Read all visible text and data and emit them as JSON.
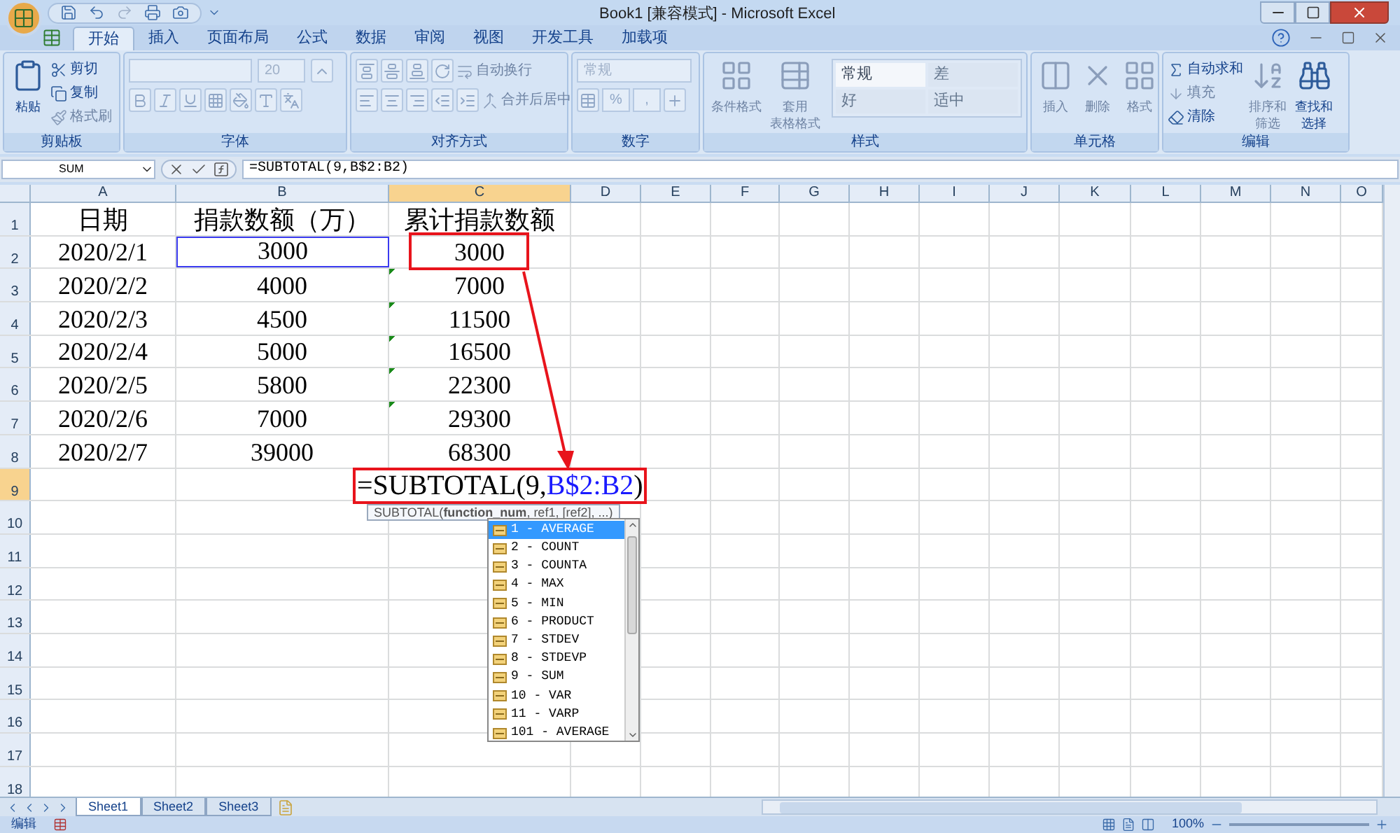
{
  "window": {
    "title": "Book1  [兼容模式] - Microsoft Excel"
  },
  "tabs": [
    {
      "label": "开始",
      "selected": true
    },
    {
      "label": "插入",
      "selected": false
    },
    {
      "label": "页面布局",
      "selected": false
    },
    {
      "label": "公式",
      "selected": false
    },
    {
      "label": "数据",
      "selected": false
    },
    {
      "label": "审阅",
      "selected": false
    },
    {
      "label": "视图",
      "selected": false
    },
    {
      "label": "开发工具",
      "selected": false
    },
    {
      "label": "加载项",
      "selected": false
    }
  ],
  "ribbon": [
    {
      "kind": "clipboard",
      "title": "剪贴板",
      "large": {
        "label": "粘贴",
        "disabled": false
      },
      "small": [
        {
          "label": "剪切",
          "disabled": false
        },
        {
          "label": "复制",
          "disabled": false
        },
        {
          "label": "格式刷",
          "disabled": true
        }
      ]
    },
    {
      "kind": "font",
      "title": "字体",
      "font_size": "20"
    },
    {
      "kind": "alignment",
      "title": "对齐方式",
      "wrap": "自动换行",
      "merge": "合并后居中"
    },
    {
      "kind": "number",
      "title": "数字",
      "format": "常规",
      "percent": "%",
      "comma": ","
    },
    {
      "kind": "styles",
      "title": "样式",
      "large": [
        {
          "lines": [
            "条件格式"
          ]
        },
        {
          "lines": [
            "套用",
            "表格格式"
          ]
        }
      ],
      "gallery": [
        {
          "label": "常规",
          "selected": true
        },
        {
          "label": "差",
          "selected": false
        },
        {
          "label": "好",
          "selected": false
        },
        {
          "label": "适中",
          "selected": false
        }
      ]
    },
    {
      "kind": "cells",
      "title": "单元格",
      "large": [
        {
          "lines": [
            "插入"
          ]
        },
        {
          "lines": [
            "删除"
          ]
        },
        {
          "lines": [
            "格式"
          ]
        }
      ]
    },
    {
      "kind": "editing",
      "title": "编辑",
      "small": [
        {
          "label": "自动求和",
          "disabled": false
        },
        {
          "label": "填充",
          "disabled": true
        },
        {
          "label": "清除",
          "disabled": false
        }
      ],
      "large": [
        {
          "lines": [
            "排序和",
            "筛选"
          ],
          "disabled": true
        },
        {
          "lines": [
            "查找和",
            "选择"
          ],
          "disabled": false
        }
      ]
    }
  ],
  "formula_bar": {
    "name_box": "SUM",
    "formula": "=SUBTOTAL(9,B$2:B2)"
  },
  "columns": [
    {
      "label": "A",
      "selected": false
    },
    {
      "label": "B",
      "selected": false
    },
    {
      "label": "C",
      "selected": true
    },
    {
      "label": "D",
      "selected": false
    },
    {
      "label": "E",
      "selected": false
    },
    {
      "label": "F",
      "selected": false
    },
    {
      "label": "G",
      "selected": false
    },
    {
      "label": "H",
      "selected": false
    },
    {
      "label": "I",
      "selected": false
    },
    {
      "label": "J",
      "selected": false
    },
    {
      "label": "K",
      "selected": false
    },
    {
      "label": "L",
      "selected": false
    },
    {
      "label": "M",
      "selected": false
    },
    {
      "label": "N",
      "selected": false
    },
    {
      "label": "O",
      "selected": false
    }
  ],
  "rows": [
    {
      "number": "1",
      "selected": false,
      "cells": [
        {
          "text": "日期",
          "reference": false,
          "marker": false
        },
        {
          "text": "捐款数额（万）",
          "reference": false,
          "marker": false
        },
        {
          "text": "累计捐款数额",
          "reference": false,
          "marker": false
        }
      ]
    },
    {
      "number": "2",
      "selected": false,
      "cells": [
        {
          "text": "2020/2/1",
          "reference": false,
          "marker": false
        },
        {
          "text": "3000",
          "reference": true,
          "marker": false
        },
        {
          "text": "3000",
          "reference": false,
          "marker": false
        }
      ]
    },
    {
      "number": "3",
      "selected": false,
      "cells": [
        {
          "text": "2020/2/2",
          "reference": false,
          "marker": false
        },
        {
          "text": "4000",
          "reference": false,
          "marker": false
        },
        {
          "text": "7000",
          "reference": false,
          "marker": true
        }
      ]
    },
    {
      "number": "4",
      "selected": false,
      "cells": [
        {
          "text": "2020/2/3",
          "reference": false,
          "marker": false
        },
        {
          "text": "4500",
          "reference": false,
          "marker": false
        },
        {
          "text": "11500",
          "reference": false,
          "marker": true
        }
      ]
    },
    {
      "number": "5",
      "selected": false,
      "cells": [
        {
          "text": "2020/2/4",
          "reference": false,
          "marker": false
        },
        {
          "text": "5000",
          "reference": false,
          "marker": false
        },
        {
          "text": "16500",
          "reference": false,
          "marker": true
        }
      ]
    },
    {
      "number": "6",
      "selected": false,
      "cells": [
        {
          "text": "2020/2/5",
          "reference": false,
          "marker": false
        },
        {
          "text": "5800",
          "reference": false,
          "marker": false
        },
        {
          "text": "22300",
          "reference": false,
          "marker": true
        }
      ]
    },
    {
      "number": "7",
      "selected": false,
      "cells": [
        {
          "text": "2020/2/6",
          "reference": false,
          "marker": false
        },
        {
          "text": "7000",
          "reference": false,
          "marker": false
        },
        {
          "text": "29300",
          "reference": false,
          "marker": true
        }
      ]
    },
    {
      "number": "8",
      "selected": false,
      "cells": [
        {
          "text": "2020/2/7",
          "reference": false,
          "marker": false
        },
        {
          "text": "39000",
          "reference": false,
          "marker": false
        },
        {
          "text": "68300",
          "reference": false,
          "marker": false
        }
      ]
    },
    {
      "number": "9",
      "selected": true
    },
    {
      "number": "10",
      "selected": false
    },
    {
      "number": "11",
      "selected": false
    },
    {
      "number": "12",
      "selected": false
    },
    {
      "number": "13",
      "selected": false
    },
    {
      "number": "14",
      "selected": false
    },
    {
      "number": "15",
      "selected": false
    },
    {
      "number": "16",
      "selected": false
    },
    {
      "number": "17",
      "selected": false
    },
    {
      "number": "18",
      "selected": false
    }
  ],
  "cell_editor": {
    "parts": [
      {
        "kind": "plain",
        "text": "=SUBTOTAL(9, "
      },
      {
        "kind": "reference",
        "text": "B$2:B2"
      },
      {
        "kind": "plain",
        "text": ")"
      }
    ]
  },
  "tooltip": "SUBTOTAL(**function_num**, ref1, [ref2], ...)",
  "autocomplete": [
    {
      "label": "1 - AVERAGE",
      "selected": true
    },
    {
      "label": "2 - COUNT",
      "selected": false
    },
    {
      "label": "3 - COUNTA",
      "selected": false
    },
    {
      "label": "4 - MAX",
      "selected": false
    },
    {
      "label": "5 - MIN",
      "selected": false
    },
    {
      "label": "6 - PRODUCT",
      "selected": false
    },
    {
      "label": "7 - STDEV",
      "selected": false
    },
    {
      "label": "8 - STDEVP",
      "selected": false
    },
    {
      "label": "9 - SUM",
      "selected": false
    },
    {
      "label": "10 - VAR",
      "selected": false
    },
    {
      "label": "11 - VARP",
      "selected": false
    },
    {
      "label": "101 - AVERAGE",
      "selected": false
    }
  ],
  "sheets": [
    {
      "label": "Sheet1",
      "selected": true
    },
    {
      "label": "Sheet2",
      "selected": false
    },
    {
      "label": "Sheet3",
      "selected": false
    }
  ],
  "status_bar": {
    "mode": "编辑",
    "zoom": "100%"
  }
}
